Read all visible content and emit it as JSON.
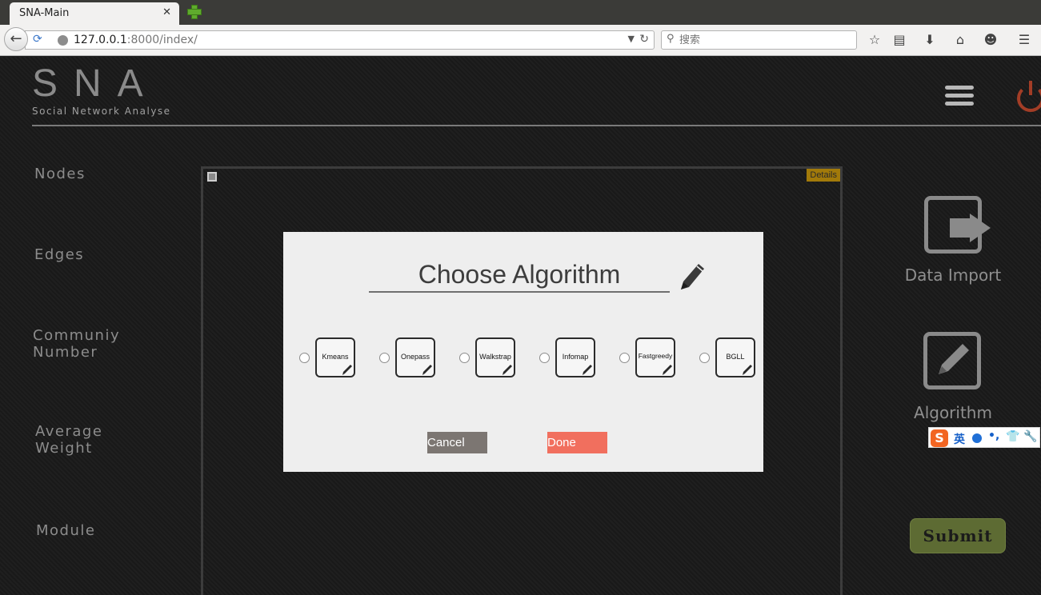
{
  "browser": {
    "tab_title": "SNA-Main",
    "tab_close": "✕",
    "url_host": "127.0.0.1",
    "url_rest": ":8000/index/",
    "search_placeholder": "搜索"
  },
  "header": {
    "logo_title": "SNA",
    "logo_subtitle": "Social Network Analyse"
  },
  "stats": [
    {
      "label": "Nodes"
    },
    {
      "label": "Edges"
    },
    {
      "label": "Communiy\nNumber"
    },
    {
      "label": "Average\nWeight"
    },
    {
      "label": "Module"
    }
  ],
  "canvas": {
    "details_label": "Details"
  },
  "side_actions": {
    "data_import_label": "Data Import",
    "algorithm_label": "Algorithm",
    "submit_label": "Submit"
  },
  "ime": {
    "logo": "S",
    "lang": "英",
    "punct": "•,",
    "shirt": "👕",
    "tool": "🔧"
  },
  "modal": {
    "title": "Choose Algorithm",
    "algorithms": [
      {
        "label": "Kmeans"
      },
      {
        "label": "Onepass"
      },
      {
        "label": "Walkstrap"
      },
      {
        "label": "Infomap"
      },
      {
        "label": "Fastgreedy"
      },
      {
        "label": "BGLL"
      }
    ],
    "cancel_label": "Cancel",
    "done_label": "Done"
  },
  "colors": {
    "done": "#f16f5e",
    "cancel": "#7c7672",
    "details_badge": "#a27a0a",
    "submit": "#5d6b33",
    "power": "#a33d26"
  }
}
